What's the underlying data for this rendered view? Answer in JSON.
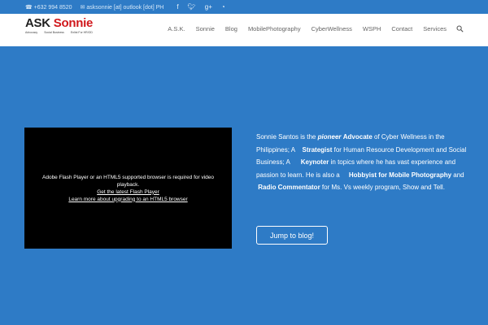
{
  "topbar": {
    "phone": "+632 994 8520",
    "email": "asksonnie [at] outlook [dot] PH",
    "social": [
      {
        "icon": "facebook-icon",
        "glyph": "f"
      },
      {
        "icon": "twitter-icon",
        "glyph": "t"
      },
      {
        "icon": "google-plus-icon",
        "glyph": "g+"
      },
      {
        "icon": "rss-icon",
        "glyph": "rss"
      }
    ]
  },
  "logo": {
    "ask": "ASK",
    "sonnie": "Sonnie",
    "tag1": "Advocacy",
    "tag2": "Social Business",
    "tag3": "Enlist For HR/OD"
  },
  "nav": {
    "items": [
      "A.S.K.",
      "Sonnie",
      "Blog",
      "MobilePhotography",
      "CyberWellness",
      "WSPH",
      "Contact",
      "Services"
    ]
  },
  "video": {
    "message": "Adobe Flash Player or an HTML5 supported browser is required for video playback.",
    "link1": "Get the latest Flash Player",
    "link2": "Learn more about upgrading to an HTML5 browser"
  },
  "intro": {
    "p1": "Sonnie Santos is the ",
    "pioneer": "pioneer",
    "advocate": "Advocate",
    "p2": " of Cyber Wellness in the Philippines; A ",
    "strategist": "Strategist",
    "p3": " for Human Resource Development and Social Business; A ",
    "keynoter": "Keynoter",
    "p4": " in topics where he has vast experience and passion to learn. He is also a ",
    "hobbyist": "Hobbyist for Mobile Photography",
    "p5": " and ",
    "commentator": "Radio Commentator",
    "p6": " for Ms. Vs weekly program, Show and Tell."
  },
  "cta": {
    "label": "Jump to blog!"
  },
  "colors": {
    "hero": "#2e7bc6",
    "brand_red": "#d0181c",
    "nav_text": "#666666"
  }
}
